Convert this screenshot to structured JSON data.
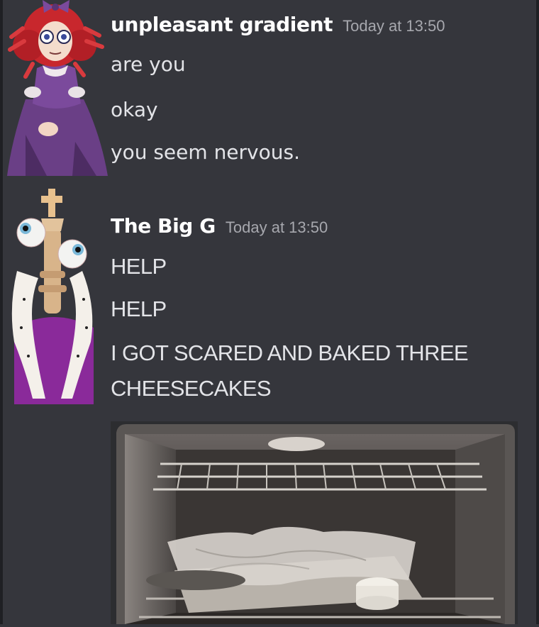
{
  "messages": [
    {
      "username": "unpleasant gradient",
      "timestamp": "Today at 13:50",
      "avatar_icon": "ragdoll-avatar-icon",
      "lines": [
        "are you",
        "okay",
        "you seem nervous."
      ]
    },
    {
      "username": "The Big G",
      "timestamp": "Today at 13:50",
      "avatar_icon": "chess-king-avatar-icon",
      "lines": [
        "HELP",
        "HELP",
        "I GOT SCARED AND BAKED THREE",
        "CHEESECAKES"
      ],
      "attachment": {
        "type": "image",
        "depicts": "oven-photo-icon"
      }
    }
  ],
  "colors": {
    "background": "#35363c",
    "username": "#ffffff",
    "timestamp": "#a7a8ae",
    "message_text": "#e3e4e8"
  }
}
